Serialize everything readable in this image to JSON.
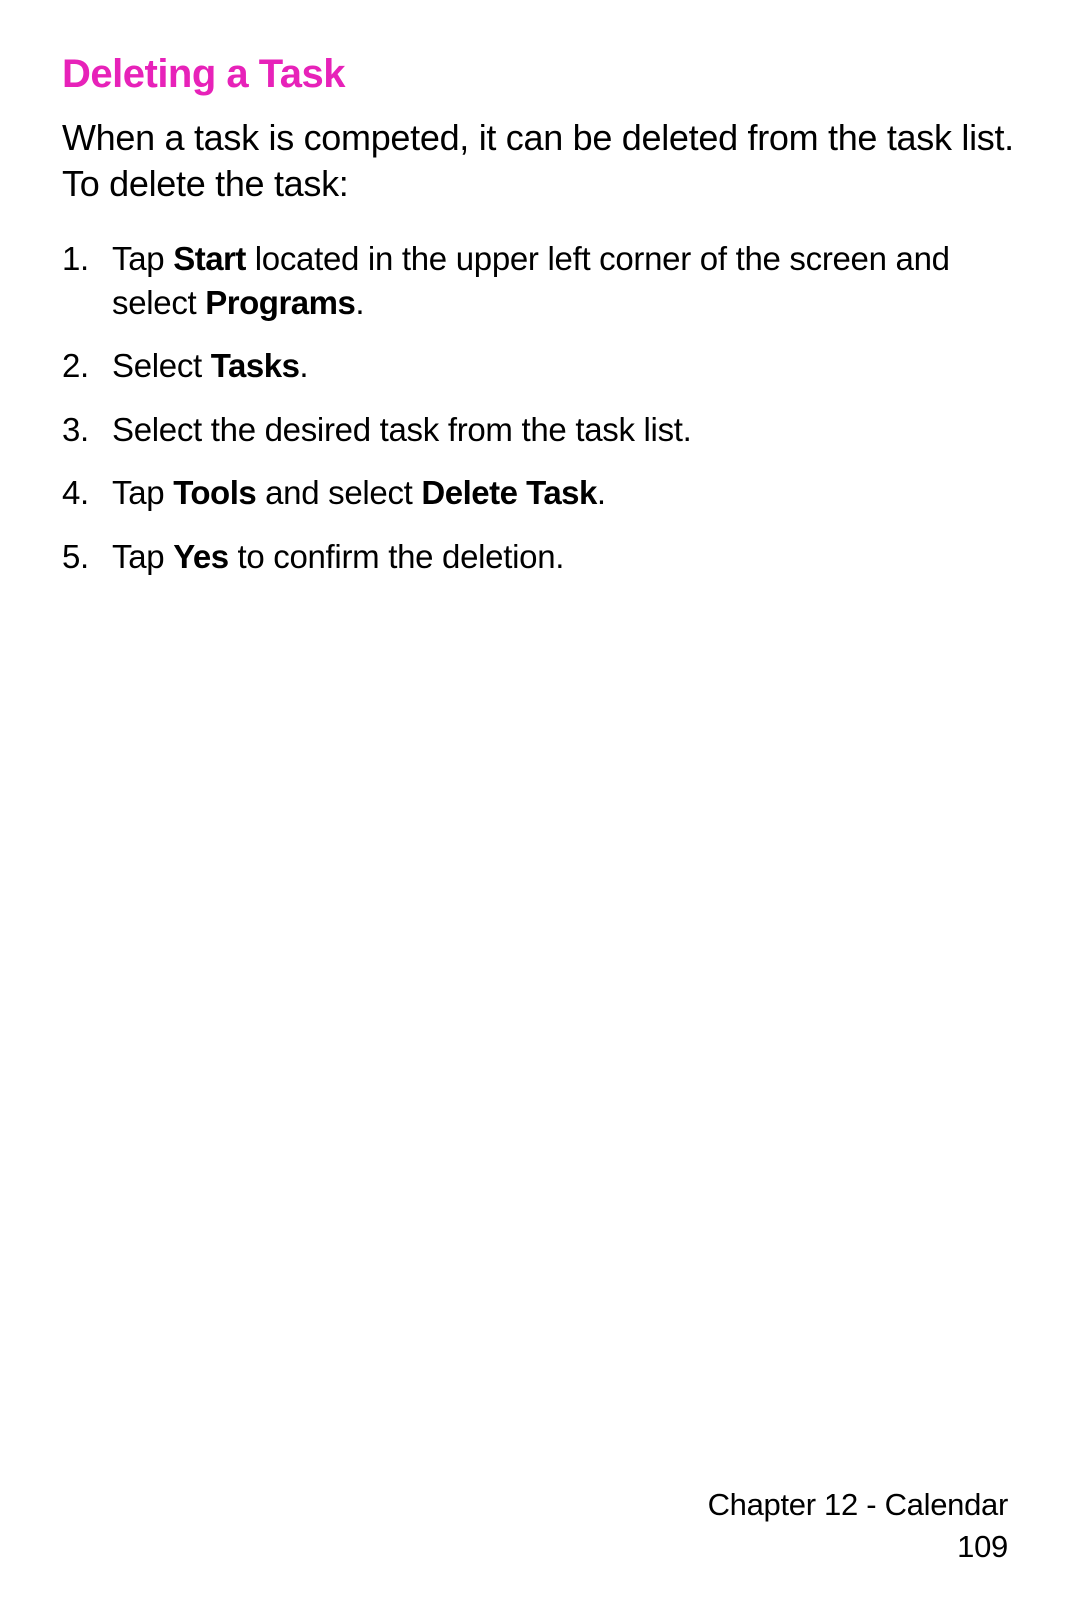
{
  "heading": "Deleting a Task",
  "intro": "When a task is competed, it can be deleted from the task list. To delete the task:",
  "steps": [
    {
      "num": "1.",
      "pre": "Tap ",
      "b1": "Start",
      "mid": " located in the upper left corner of the screen and select ",
      "b2": "Programs",
      "post": "."
    },
    {
      "num": "2.",
      "pre": "Select ",
      "b1": "Tasks",
      "mid": "",
      "b2": "",
      "post": "."
    },
    {
      "num": "3.",
      "pre": "Select the desired task from the task list.",
      "b1": "",
      "mid": "",
      "b2": "",
      "post": ""
    },
    {
      "num": "4.",
      "pre": "Tap ",
      "b1": "Tools",
      "mid": " and select ",
      "b2": "Delete Task",
      "post": "."
    },
    {
      "num": "5.",
      "pre": "Tap ",
      "b1": "Yes",
      "mid": " to confirm the deletion.",
      "b2": "",
      "post": ""
    }
  ],
  "footer": {
    "chapter": "Chapter 12 - Calendar",
    "page": "109"
  }
}
